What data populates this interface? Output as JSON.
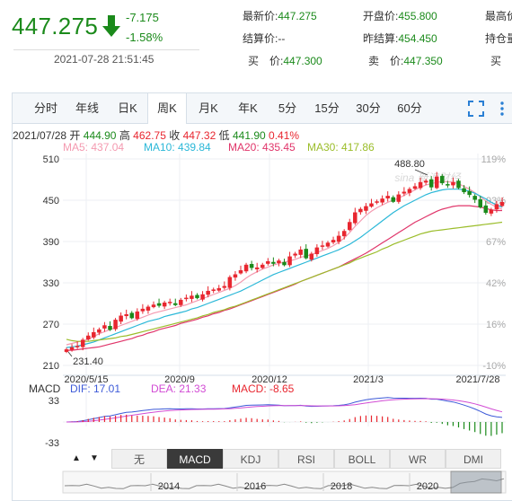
{
  "quote": {
    "price": "447.275",
    "change": "-7.175",
    "change_pct": "-1.58%",
    "datetime": "2021-07-28 21:51:45",
    "fields": [
      {
        "label": "最新价:",
        "value": "447.275"
      },
      {
        "label": "开盘价:",
        "value": "455.800"
      },
      {
        "label": "最高价",
        "value": ""
      },
      {
        "label": "结算价:",
        "value": "--"
      },
      {
        "label": "昨结算:",
        "value": "454.450"
      },
      {
        "label": "持仓量",
        "value": ""
      },
      {
        "label": "买　价:",
        "value": "447.300"
      },
      {
        "label": "卖　价:",
        "value": "447.350"
      },
      {
        "label": "买　",
        "value": ""
      }
    ]
  },
  "tabs": [
    "分时",
    "年线",
    "日K",
    "周K",
    "月K",
    "年K",
    "5分",
    "15分",
    "30分",
    "60分"
  ],
  "active_tab": "周K",
  "toolbar": {
    "fullscreen_icon": "fullscreen-icon",
    "settings_icon": "more-vertical-icon"
  },
  "info": {
    "date": "2021/07/28",
    "open_label": "开",
    "open": "444.90",
    "high_label": "高",
    "high": "462.75",
    "close_label": "收",
    "close": "447.32",
    "low_label": "低",
    "low": "441.90",
    "pct": "0.41%"
  },
  "ma": [
    {
      "label": "MA5: 437.04",
      "color": "#f49ab0"
    },
    {
      "label": "MA10: 439.84",
      "color": "#2bb8d8"
    },
    {
      "label": "MA20: 435.45",
      "color": "#e0356a"
    },
    {
      "label": "MA30: 417.86",
      "color": "#9bbd2a"
    }
  ],
  "chart_data": {
    "type": "candlestick",
    "y_ticks": [
      "510",
      "450",
      "390",
      "330",
      "270",
      "210"
    ],
    "y_ticks_right": [
      "119%",
      "93%",
      "67%",
      "42%",
      "16%",
      "-10%"
    ],
    "x_ticks": [
      "2020/5/15",
      "2020/9",
      "2020/12",
      "2021/3",
      "2021/7/28"
    ],
    "ylim": [
      210,
      510
    ],
    "high_label": "488.80",
    "low_label": "231.40",
    "watermark": "sina 新浪财经",
    "close_series": [
      233,
      236,
      238,
      247,
      253,
      258,
      262,
      268,
      262,
      276,
      282,
      284,
      279,
      288,
      292,
      295,
      298,
      297,
      301,
      302,
      298,
      305,
      308,
      311,
      308,
      313,
      318,
      320,
      322,
      325,
      338,
      342,
      348,
      356,
      352,
      352,
      356,
      361,
      358,
      362,
      356,
      368,
      372,
      378,
      366,
      372,
      381,
      384,
      388,
      392,
      398,
      405,
      418,
      432,
      437,
      441,
      445,
      448,
      452,
      456,
      448,
      458,
      462,
      466,
      470,
      476,
      478,
      469,
      484,
      475,
      472,
      476,
      468,
      462,
      458,
      451,
      440,
      432,
      436,
      444,
      447
    ],
    "ma5": [
      240,
      242,
      244,
      246,
      248,
      252,
      256,
      259,
      262,
      265,
      268,
      271,
      274,
      277,
      280,
      283,
      286,
      288,
      290,
      292,
      294,
      296,
      298,
      301,
      304,
      307,
      310,
      313,
      316,
      319,
      322,
      326,
      331,
      337,
      342,
      346,
      350,
      353,
      356,
      358,
      360,
      362,
      364,
      367,
      369,
      371,
      374,
      377,
      380,
      384,
      389,
      395,
      403,
      412,
      420,
      428,
      434,
      439,
      443,
      447,
      450,
      453,
      457,
      461,
      465,
      469,
      472,
      474,
      476,
      477,
      477,
      476,
      474,
      470,
      466,
      461,
      455,
      449,
      444,
      440,
      437
    ],
    "ma10": [
      236,
      237,
      238,
      240,
      242,
      244,
      247,
      250,
      253,
      256,
      259,
      262,
      265,
      268,
      271,
      274,
      276,
      278,
      281,
      283,
      285,
      287,
      289,
      292,
      294,
      297,
      300,
      303,
      306,
      309,
      312,
      315,
      318,
      322,
      326,
      330,
      334,
      338,
      342,
      345,
      348,
      351,
      354,
      357,
      360,
      363,
      366,
      369,
      372,
      375,
      378,
      382,
      386,
      391,
      396,
      402,
      408,
      414,
      420,
      426,
      432,
      437,
      442,
      446,
      450,
      454,
      458,
      461,
      463,
      465,
      466,
      466,
      466,
      465,
      463,
      460,
      456,
      452,
      447,
      443,
      440
    ],
    "ma20": [
      232,
      232,
      233,
      234,
      235,
      236,
      237,
      239,
      241,
      243,
      245,
      247,
      249,
      252,
      254,
      257,
      259,
      262,
      264,
      266,
      268,
      271,
      273,
      275,
      277,
      280,
      282,
      285,
      287,
      290,
      292,
      295,
      298,
      301,
      304,
      307,
      310,
      313,
      316,
      319,
      322,
      325,
      328,
      332,
      335,
      338,
      341,
      344,
      347,
      350,
      353,
      357,
      361,
      365,
      369,
      373,
      378,
      383,
      388,
      393,
      398,
      403,
      408,
      413,
      418,
      422,
      426,
      430,
      434,
      437,
      439,
      441,
      442,
      442,
      442,
      441,
      440,
      438,
      436,
      435,
      435
    ],
    "ma30": [
      248,
      246,
      245,
      245,
      245,
      246,
      247,
      248,
      249,
      250,
      252,
      253,
      255,
      257,
      259,
      261,
      263,
      265,
      267,
      269,
      271,
      273,
      275,
      277,
      279,
      282,
      284,
      287,
      289,
      291,
      294,
      296,
      299,
      302,
      305,
      308,
      311,
      314,
      317,
      320,
      323,
      326,
      329,
      332,
      335,
      338,
      341,
      344,
      347,
      350,
      353,
      356,
      359,
      363,
      366,
      369,
      372,
      375,
      379,
      382,
      386,
      389,
      392,
      395,
      398,
      401,
      403,
      405,
      406,
      407,
      408,
      409,
      410,
      411,
      412,
      413,
      414,
      415,
      416,
      417,
      418
    ]
  },
  "macd": {
    "label": "MACD",
    "dif": "DIF: 17.01",
    "dea": "DEA: 21.33",
    "macd": "MACD: -8.65",
    "y_top": "33",
    "y_bottom": "-33",
    "dif_color": "#3d5ad8",
    "dea_color": "#d24bd4",
    "bar_up": "#e8262f",
    "bar_down": "#1b8a1b"
  },
  "indicator_tabs": [
    "无",
    "MACD",
    "KDJ",
    "RSI",
    "BOLL",
    "WR",
    "DMI"
  ],
  "active_indicator": "MACD",
  "timeline": {
    "years": [
      "2014",
      "2016",
      "2018",
      "2020"
    ]
  }
}
